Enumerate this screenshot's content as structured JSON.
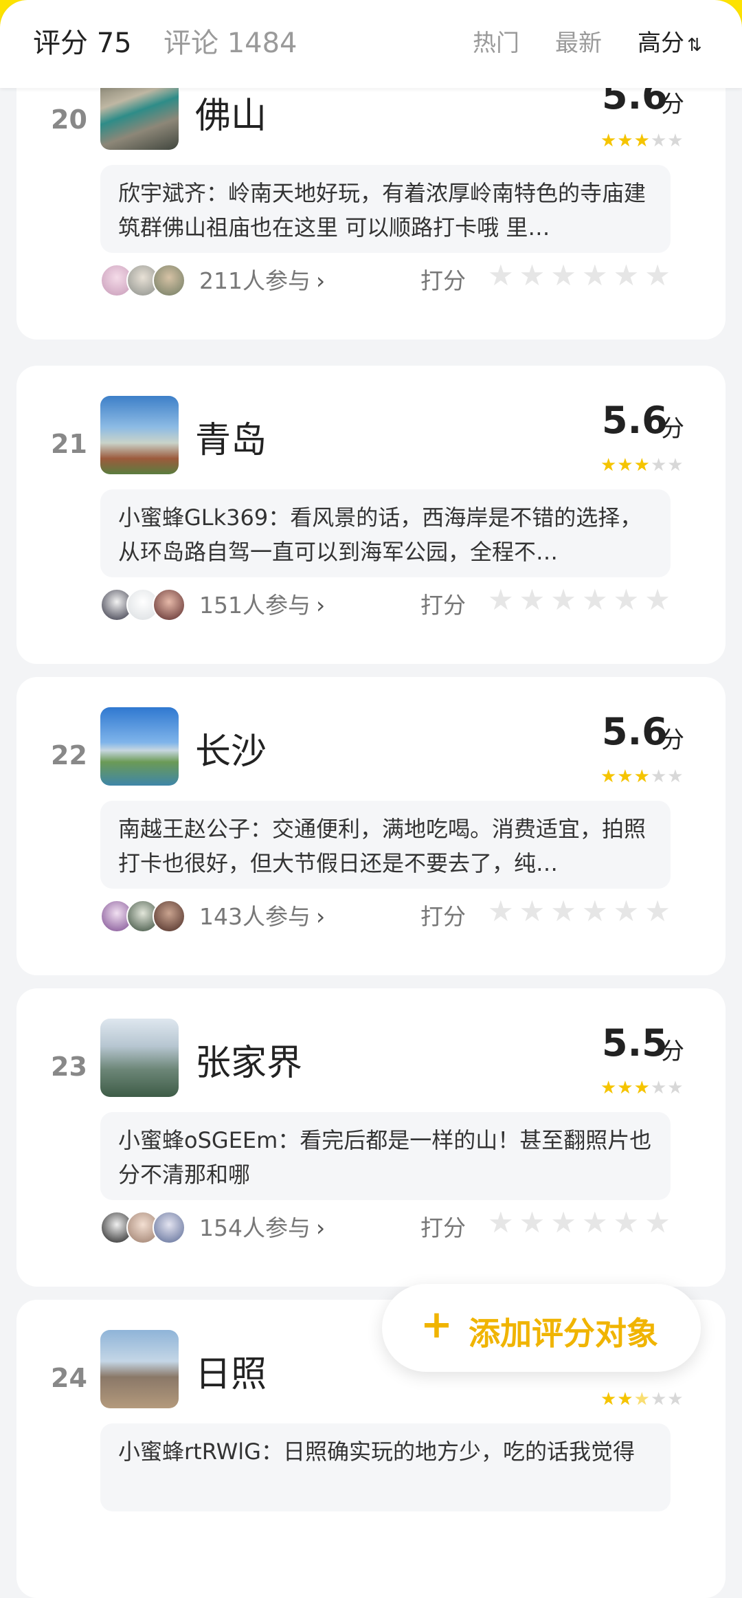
{
  "header": {
    "score_tab": "评分 75",
    "comments_tab": "评论 1484",
    "sort_hot": "热门",
    "sort_new": "最新",
    "sort_high": "高分",
    "sort_icon_glyph": "⇅"
  },
  "items": [
    {
      "rank": "20",
      "city": "佛山",
      "score": "5.6",
      "score_unit": "分",
      "stars_filled": 3,
      "comment": "欣宇斌齐：岭南天地好玩，有着浓厚岭南特色的寺庙建筑群佛山祖庙也在这里 可以顺路打卡哦 里…",
      "participants": "211人参与",
      "rate_label": "打分"
    },
    {
      "rank": "21",
      "city": "青岛",
      "score": "5.6",
      "score_unit": "分",
      "stars_filled": 3,
      "comment": "小蜜蜂GLk369：看风景的话，西海岸是不错的选择，从环岛路自驾一直可以到海军公园，全程不…",
      "participants": "151人参与",
      "rate_label": "打分"
    },
    {
      "rank": "22",
      "city": "长沙",
      "score": "5.6",
      "score_unit": "分",
      "stars_filled": 3,
      "comment": "南越王赵公子：交通便利，满地吃喝。消费适宜，拍照打卡也很好，但大节假日还是不要去了，纯…",
      "participants": "143人参与",
      "rate_label": "打分"
    },
    {
      "rank": "23",
      "city": "张家界",
      "score": "5.5",
      "score_unit": "分",
      "stars_filled": 3,
      "comment": "小蜜蜂oSGEEm：看完后都是一样的山！甚至翻照片也分不清那和哪",
      "participants": "154人参与",
      "rate_label": "打分"
    },
    {
      "rank": "24",
      "city": "日照",
      "score": "",
      "score_unit": "",
      "stars_filled": 2.5,
      "comment": "小蜜蜂rtRWlG：日照确实玩的地方少，吃的话我觉得",
      "participants": "",
      "rate_label": ""
    }
  ],
  "fab": {
    "plus": "+",
    "label": "添加评分对象"
  },
  "colors": {
    "accent_yellow": "#fde200",
    "star_yellow": "#f5c400",
    "fab_text": "#f0b400"
  }
}
